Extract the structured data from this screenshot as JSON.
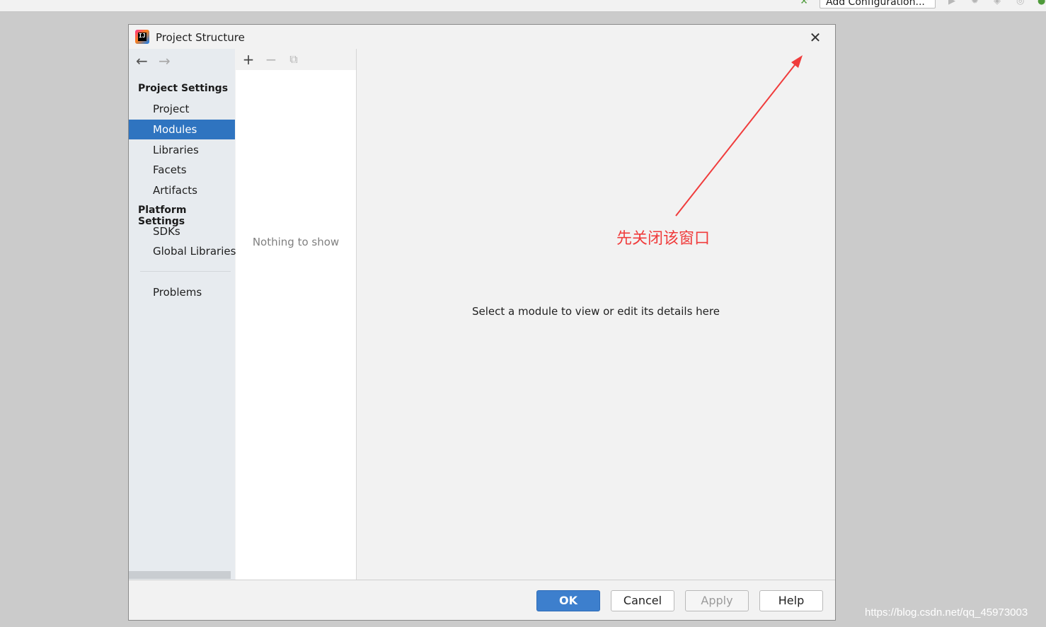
{
  "ide_toolbar": {
    "run_config_label": "Add Configuration..."
  },
  "dialog": {
    "title": "Project Structure",
    "close_symbol": "✕"
  },
  "nav": {
    "back_symbol": "←",
    "forward_symbol": "→",
    "project_settings_header": "Project Settings",
    "project_settings_items": [
      "Project",
      "Modules",
      "Libraries",
      "Facets",
      "Artifacts"
    ],
    "platform_settings_header": "Platform Settings",
    "platform_settings_items": [
      "SDKs",
      "Global Libraries"
    ],
    "problems_label": "Problems",
    "selected_item": "Modules"
  },
  "list_toolbar": {
    "add_symbol": "+",
    "remove_symbol": "−",
    "copy_symbol": "⧉"
  },
  "list_panel": {
    "empty_text": "Nothing to show"
  },
  "details": {
    "message": "Select a module to view or edit its details here"
  },
  "annotation": {
    "text": "先关闭该窗口",
    "color": "#f03c3c"
  },
  "footer": {
    "ok_label": "OK",
    "cancel_label": "Cancel",
    "apply_label": "Apply",
    "help_label": "Help"
  },
  "watermark": "https://blog.csdn.net/qq_45973003",
  "colors": {
    "selection": "#2f74c0",
    "ok_button": "#3d7fcd",
    "annotation": "#f03c3c"
  }
}
